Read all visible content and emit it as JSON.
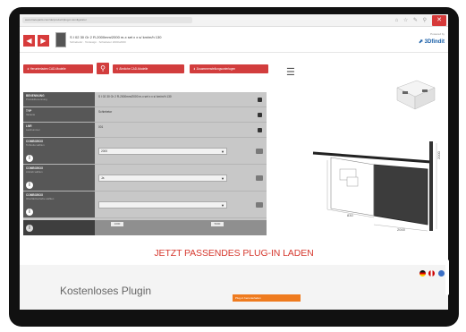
{
  "browser": {
    "url": "www.traceparts.com/de/product/plug-in-konfigurator",
    "icons": "⌂ ☆ ✎ ⚲",
    "close_label": "✕"
  },
  "header": {
    "title": "S I 02 30 Gr 2 R-2000mm/2000 m-x set x x s/ km/m/h 130",
    "subtitle": "Schiebetür · Tordesign · Schiebetor 2000x2000",
    "powered_by": "Powered by",
    "brand": "⬈ 3Dfindit"
  },
  "toolbar": {
    "buttons": [
      {
        "icon": "⬇",
        "label": "Herunterladen CAD-Modelle"
      },
      {
        "icon": "⚲",
        "label": "Ähnliche CAD-Modelle"
      },
      {
        "icon": "⬇",
        "label": "Zusammenstellungsunterlagen"
      }
    ],
    "search_icon": "⚲",
    "menu_icon": "☰"
  },
  "properties": [
    {
      "label": "BENENNUNG",
      "sub": "Produktbenennung",
      "value": "S I 02 30 Gr 2 R-2000mm/2000 m-x set x x s/ km/m/h 130",
      "kind": "text"
    },
    {
      "label": "TYP",
      "sub": "Variante",
      "value": "Schiebetor",
      "kind": "text"
    },
    {
      "label": "LNR",
      "sub": "Laufnummer",
      "value": "001",
      "kind": "text"
    },
    {
      "label": "COMBOBOX",
      "sub": "Torbreite wählen",
      "value": "2000",
      "kind": "select"
    },
    {
      "label": "COMBOBOX",
      "sub": "Antrieb wählen",
      "value": "Ja",
      "kind": "select"
    },
    {
      "label": "COMBOBOX",
      "sub": "Oberflächenfarbe wählen",
      "value": "",
      "kind": "select"
    }
  ],
  "properties_footer": {
    "value_min": "1000",
    "value_max": "5000"
  },
  "cta": {
    "label": "JETZT PASSENDES PLUG-IN LADEN"
  },
  "bottom": {
    "title": "Kostenloses Plugin",
    "download_label": "Plug-in herunterladen"
  },
  "drawing": {
    "dim_width": "2000",
    "dim_height": "2000",
    "dim_small": "830"
  },
  "colors": {
    "accent": "#d23d3d",
    "cta": "#d6392f",
    "panel_dark": "#575757"
  }
}
